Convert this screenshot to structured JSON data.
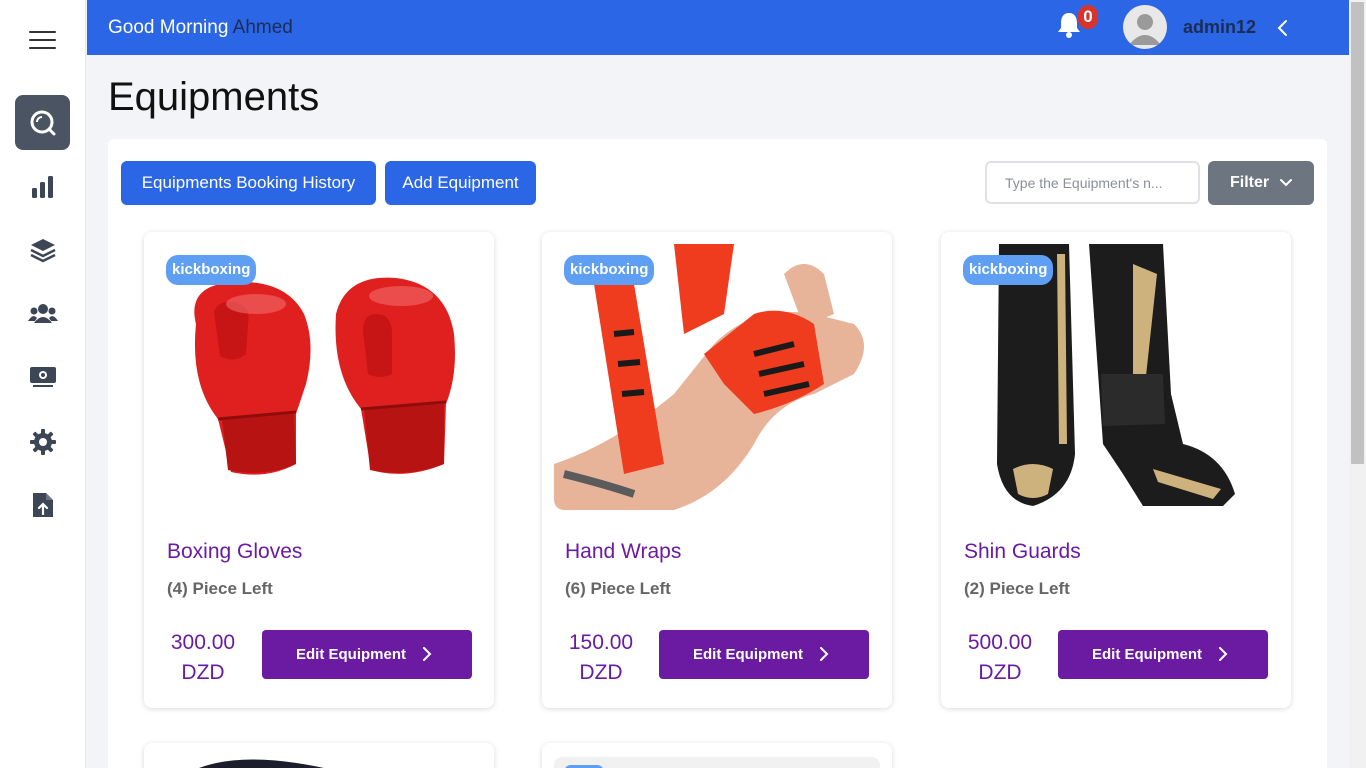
{
  "header": {
    "greeting": "Good Morning",
    "user_name": "Ahmed",
    "notification_count": "0",
    "admin_name": "admin12"
  },
  "sidebar": {
    "items": [
      {
        "icon": "search-icon",
        "active": true
      },
      {
        "icon": "bar-chart-icon",
        "active": false
      },
      {
        "icon": "layers-icon",
        "active": false
      },
      {
        "icon": "users-icon",
        "active": false
      },
      {
        "icon": "money-icon",
        "active": false
      },
      {
        "icon": "gear-icon",
        "active": false
      },
      {
        "icon": "file-upload-icon",
        "active": false
      }
    ]
  },
  "page": {
    "title": "Equipments"
  },
  "toolbar": {
    "booking_history_label": "Equipments Booking History",
    "add_equipment_label": "Add Equipment",
    "search_placeholder": "Type the Equipment's n...",
    "filter_label": "Filter"
  },
  "equipments": [
    {
      "tag": "kickboxing",
      "name": "Boxing Gloves",
      "stock": "(4) Piece Left",
      "price": "300.00",
      "currency": "DZD",
      "edit_label": "Edit Equipment"
    },
    {
      "tag": "kickboxing",
      "name": "Hand Wraps",
      "stock": "(6) Piece Left",
      "price": "150.00",
      "currency": "DZD",
      "edit_label": "Edit Equipment"
    },
    {
      "tag": "kickboxing",
      "name": "Shin Guards",
      "stock": "(2) Piece Left",
      "price": "500.00",
      "currency": "DZD",
      "edit_label": "Edit Equipment"
    }
  ],
  "colors": {
    "primary_blue": "#2a66e5",
    "purple": "#6a1ba2",
    "tag_blue": "#5e9ef3",
    "sidebar_active": "#4a5462",
    "badge_red": "#d9342b"
  }
}
